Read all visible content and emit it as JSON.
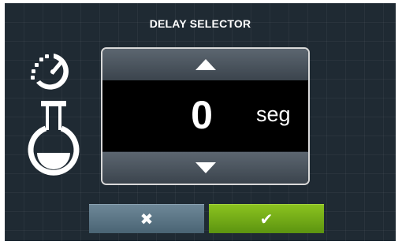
{
  "header": {
    "title": "DELAY SELECTOR"
  },
  "selector": {
    "value": "0",
    "unit": "seg",
    "up_icon": "triangle-up-icon",
    "down_icon": "triangle-down-icon"
  },
  "actions": {
    "cancel_icon": "close-icon",
    "confirm_icon": "checkmark-icon",
    "cancel_symbol": "✖",
    "confirm_symbol": "✔",
    "cancel_color": "#5a7585",
    "confirm_color": "#76ad18"
  },
  "illustration": {
    "icon": "timer-flask-icon"
  },
  "colors": {
    "background": "#1f2a33",
    "display": "#000000",
    "text": "#ffffff"
  }
}
